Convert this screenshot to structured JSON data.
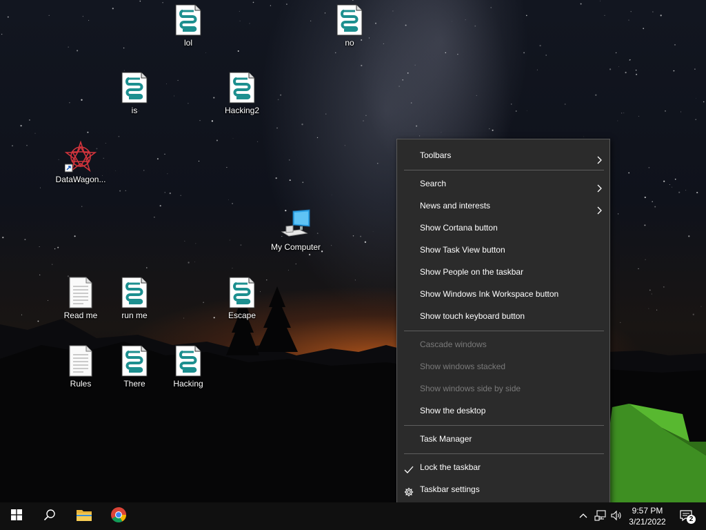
{
  "desktop": {
    "icons": [
      {
        "name": "lol",
        "type": "script"
      },
      {
        "name": "no",
        "type": "script"
      },
      {
        "name": "is",
        "type": "script"
      },
      {
        "name": "Hacking2",
        "type": "script"
      },
      {
        "name": "DataWagon...",
        "type": "shortcut"
      },
      {
        "name": "My Computer",
        "type": "computer"
      },
      {
        "name": "Read me",
        "type": "text"
      },
      {
        "name": "run me",
        "type": "script"
      },
      {
        "name": "Escape",
        "type": "script"
      },
      {
        "name": "Rules",
        "type": "text"
      },
      {
        "name": "There",
        "type": "script"
      },
      {
        "name": "Hacking",
        "type": "script"
      }
    ]
  },
  "context_menu": {
    "toolbars": "Toolbars",
    "search": "Search",
    "news": "News and interests",
    "cortana": "Show Cortana button",
    "task_view": "Show Task View button",
    "people": "Show People on the taskbar",
    "ink": "Show Windows Ink Workspace button",
    "touch_keyboard": "Show touch keyboard button",
    "cascade": "Cascade windows",
    "stacked": "Show windows stacked",
    "side_by_side": "Show windows side by side",
    "show_desktop": "Show the desktop",
    "task_manager": "Task Manager",
    "lock": "Lock the taskbar",
    "settings": "Taskbar settings"
  },
  "taskbar": {
    "time": "9:57 PM",
    "date": "3/21/2022",
    "notification_count": "2"
  },
  "colors": {
    "menu_bg": "#2b2b2b",
    "taskbar_bg": "#101010",
    "disabled_text": "#7a7a7a"
  }
}
